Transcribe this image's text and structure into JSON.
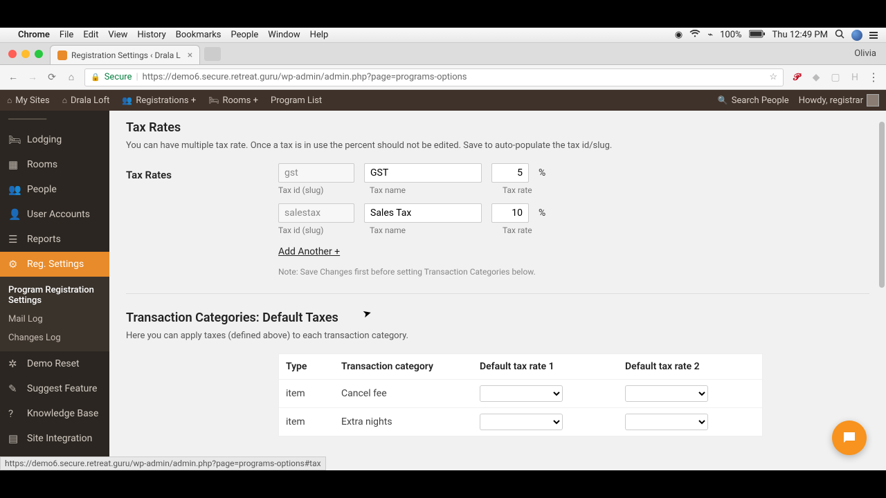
{
  "mac_menu": {
    "app": "Chrome",
    "items": [
      "File",
      "Edit",
      "View",
      "History",
      "Bookmarks",
      "People",
      "Window",
      "Help"
    ],
    "battery_pct": "100%",
    "clock": "Thu 12:49 PM"
  },
  "browser": {
    "tab_title": "Registration Settings ‹ Drala L",
    "profile_name": "Olivia",
    "secure_label": "Secure",
    "url": "https://demo6.secure.retreat.guru/wp-admin/admin.php?page=programs-options",
    "status_url": "https://demo6.secure.retreat.guru/wp-admin/admin.php?page=programs-options#tax"
  },
  "wpbar": {
    "my_sites": "My Sites",
    "site_name": "Drala Loft",
    "registrations": "Registrations +",
    "rooms": "Rooms +",
    "program_list": "Program List",
    "search_placeholder": "Search People",
    "howdy": "Howdy, registrar"
  },
  "sidebar": {
    "items": [
      {
        "label": "Lodging",
        "icon": "🛏"
      },
      {
        "label": "Rooms",
        "icon": "▦"
      },
      {
        "label": "People",
        "icon": "👥"
      },
      {
        "label": "User Accounts",
        "icon": "👤"
      },
      {
        "label": "Reports",
        "icon": "☰"
      },
      {
        "label": "Reg. Settings",
        "icon": "⚙",
        "active": true
      },
      {
        "label": "Demo Reset",
        "icon": "✲"
      },
      {
        "label": "Suggest Feature",
        "icon": "✎"
      },
      {
        "label": "Knowledge Base",
        "icon": "?"
      },
      {
        "label": "Site Integration",
        "icon": "▤"
      }
    ],
    "sub": [
      "Program Registration Settings",
      "Mail Log",
      "Changes Log"
    ]
  },
  "main": {
    "tax_rates_heading": "Tax Rates",
    "tax_rates_desc": "You can have multiple tax rate. Once a tax is in use the percent should not be edited. Save to auto-populate the tax id/slug.",
    "tax_rates_label": "Tax Rates",
    "slug_label": "Tax id (slug)",
    "name_label": "Tax name",
    "rate_label": "Tax rate",
    "taxes": [
      {
        "slug": "gst",
        "name": "GST",
        "rate": "5"
      },
      {
        "slug": "salestax",
        "name": "Sales Tax",
        "rate": "10"
      }
    ],
    "add_another": "Add Another +",
    "note": "Note: Save Changes first before setting Transaction Categories below.",
    "trans_heading": "Transaction Categories: Default Taxes",
    "trans_desc": "Here you can apply taxes (defined above) to each transaction category.",
    "table": {
      "headers": [
        "Type",
        "Transaction category",
        "Default tax rate 1",
        "Default tax rate 2"
      ],
      "rows": [
        {
          "type": "item",
          "cat": "Cancel fee"
        },
        {
          "type": "item",
          "cat": "Extra nights"
        }
      ]
    }
  }
}
